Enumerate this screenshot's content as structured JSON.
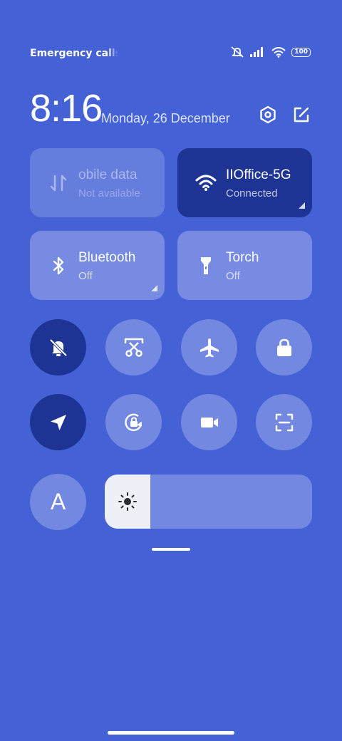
{
  "status_bar": {
    "carrier_text": "Emergency calls o",
    "battery_level": "100"
  },
  "header": {
    "time": "8:16",
    "date": "Monday, 26 December"
  },
  "tiles": {
    "mobile_data": {
      "title": "obile data",
      "subtitle": "Not available"
    },
    "wifi": {
      "title": "IIOffice-5G",
      "subtitle": "Connected"
    },
    "bluetooth": {
      "title": "Bluetooth",
      "subtitle": "Off"
    },
    "torch": {
      "title": "Torch",
      "subtitle": "Off"
    }
  },
  "font_button": {
    "label": "A"
  },
  "brightness": {
    "level_fraction": 0.22
  },
  "colors": {
    "background": "#4461d6",
    "active": "#1d3495"
  }
}
